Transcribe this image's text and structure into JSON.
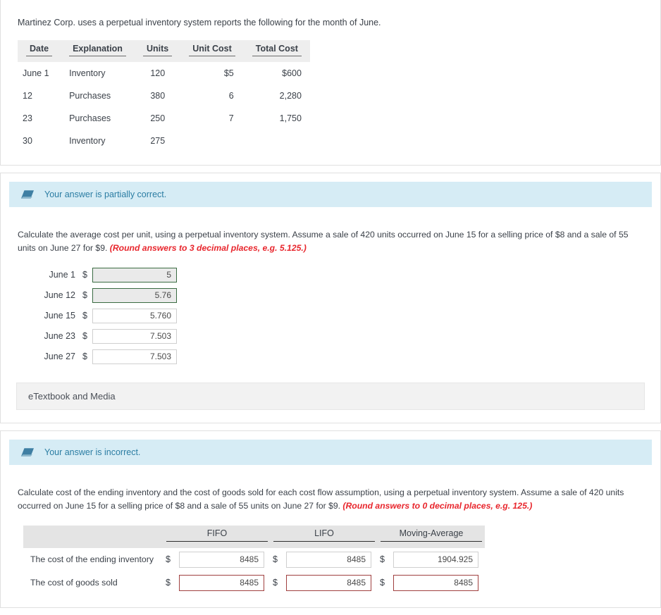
{
  "intro": {
    "text": "Martinez Corp. uses a perpetual inventory system reports the following for the month of June."
  },
  "inventory_table": {
    "headers": [
      "Date",
      "Explanation",
      "Units",
      "Unit Cost",
      "Total Cost"
    ],
    "rows": [
      {
        "date": "June 1",
        "explanation": "Inventory",
        "units": "120",
        "unit_cost": "$5",
        "total_cost": "$600"
      },
      {
        "date": "12",
        "explanation": "Purchases",
        "units": "380",
        "unit_cost": "6",
        "total_cost": "2,280"
      },
      {
        "date": "23",
        "explanation": "Purchases",
        "units": "250",
        "unit_cost": "7",
        "total_cost": "1,750"
      },
      {
        "date": "30",
        "explanation": "Inventory",
        "units": "275",
        "unit_cost": "",
        "total_cost": ""
      }
    ]
  },
  "part_a": {
    "banner": {
      "icon": "eraser-icon",
      "text": "Your answer is partially correct.",
      "background": "#d6ecf5",
      "text_color": "#2b7da3"
    },
    "prompt_main": "Calculate the average cost per unit, using a perpetual inventory system. Assume a sale of 420 units occurred on June 15 for a selling price of $8 and a sale of 55 units on June 27 for $9. ",
    "prompt_note": "(Round answers to 3 decimal places, e.g. 5.125.)",
    "currency_symbol": "$",
    "answers": [
      {
        "label": "June 1",
        "value": "5",
        "state": "locked"
      },
      {
        "label": "June 12",
        "value": "5.76",
        "state": "locked"
      },
      {
        "label": "June 15",
        "value": "5.760",
        "state": "open"
      },
      {
        "label": "June 23",
        "value": "7.503",
        "state": "open"
      },
      {
        "label": "June 27",
        "value": "7.503",
        "state": "open"
      }
    ],
    "etextbook_label": "eTextbook and Media"
  },
  "part_b": {
    "banner": {
      "icon": "eraser-icon",
      "text": "Your answer is incorrect.",
      "background": "#d6ecf5",
      "text_color": "#2b7da3"
    },
    "prompt_main": "Calculate cost of the ending inventory and the cost of goods sold for each cost flow assumption, using a perpetual inventory system. Assume a sale of 420 units occurred on June 15 for a selling price of $8 and a sale of 55 units on June 27 for $9. ",
    "prompt_note": "(Round answers to 0 decimal places, e.g. 125.)",
    "currency_symbol": "$",
    "columns": [
      "FIFO",
      "LIFO",
      "Moving-Average"
    ],
    "rows": [
      {
        "label": "The cost of the ending inventory",
        "cells": [
          {
            "value": "8485",
            "state": "open"
          },
          {
            "value": "8485",
            "state": "open"
          },
          {
            "value": "1904.925",
            "state": "open"
          }
        ]
      },
      {
        "label": "The cost of goods sold",
        "cells": [
          {
            "value": "8485",
            "state": "wrong"
          },
          {
            "value": "8485",
            "state": "wrong"
          },
          {
            "value": "8485",
            "state": "wrong"
          }
        ]
      }
    ]
  },
  "colors": {
    "banner_bg": "#d6ecf5",
    "banner_text": "#2b7da3",
    "note_red": "#e8262d",
    "locked_border_green": "#3a6b42",
    "wrong_border_red": "#a0403f",
    "table_header_bg": "#e4e4e4"
  }
}
